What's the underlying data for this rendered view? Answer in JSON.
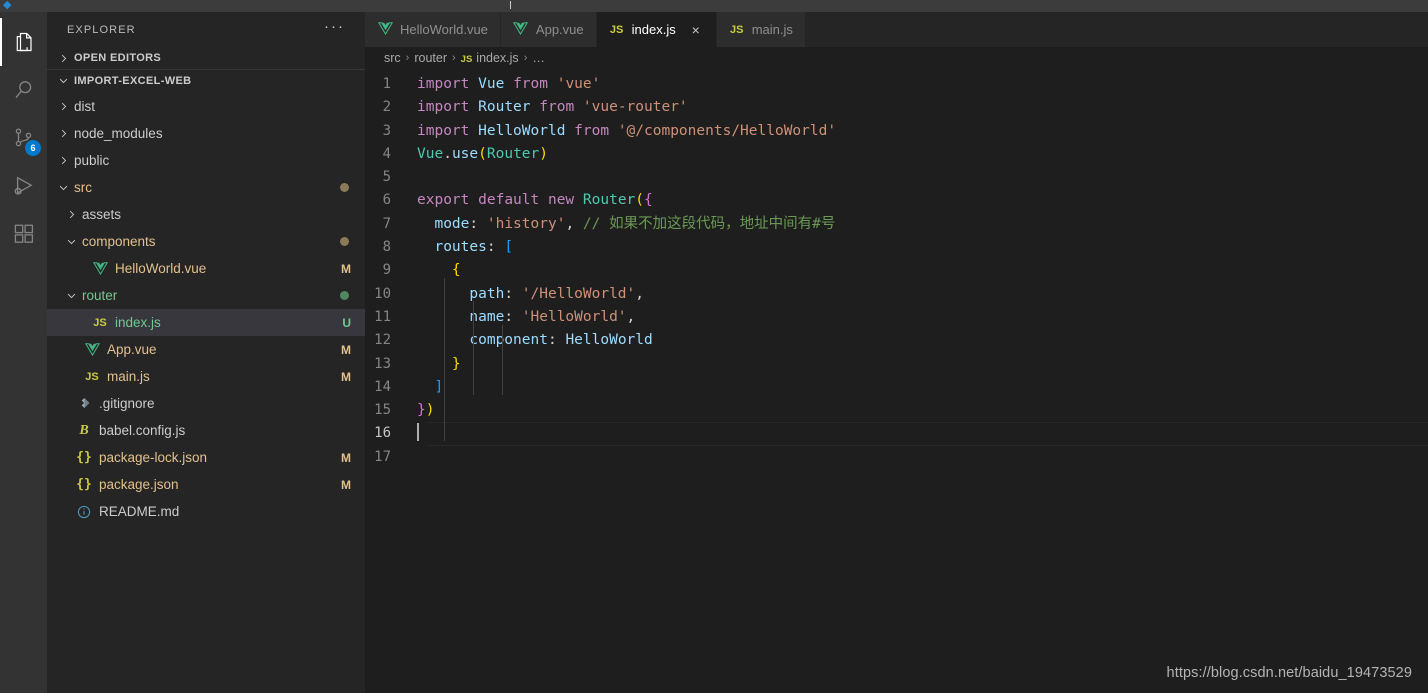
{
  "window": {
    "title_bar_color": "#3c3c3c",
    "background": "#1e1e1e"
  },
  "activity_bar": {
    "items": [
      {
        "name": "explorer",
        "icon": "files-icon",
        "active": true,
        "badge": ""
      },
      {
        "name": "search",
        "icon": "search-icon",
        "active": false,
        "badge": ""
      },
      {
        "name": "source-control",
        "icon": "source-control-icon",
        "active": false,
        "badge": "6"
      },
      {
        "name": "run-and-debug",
        "icon": "run-debug-icon",
        "active": false,
        "badge": ""
      },
      {
        "name": "extensions",
        "icon": "extensions-icon",
        "active": false,
        "badge": ""
      }
    ]
  },
  "sidebar": {
    "title": "EXPLORER",
    "more_actions": "···",
    "sections": [
      {
        "label": "OPEN EDITORS",
        "expanded": false
      },
      {
        "label": "IMPORT-EXCEL-WEB",
        "expanded": true
      }
    ],
    "tree": [
      {
        "label": "dist",
        "type": "folder",
        "depth": 1,
        "expanded": false,
        "icon": "chevron-right-icon",
        "deco": "",
        "dot": "",
        "color": "#cccccc",
        "selected": false
      },
      {
        "label": "node_modules",
        "type": "folder",
        "depth": 1,
        "expanded": false,
        "icon": "chevron-right-icon",
        "deco": "",
        "dot": "",
        "color": "#cccccc",
        "selected": false
      },
      {
        "label": "public",
        "type": "folder",
        "depth": 1,
        "expanded": false,
        "icon": "chevron-right-icon",
        "deco": "",
        "dot": "",
        "color": "#cccccc",
        "selected": false
      },
      {
        "label": "src",
        "type": "folder",
        "depth": 1,
        "expanded": true,
        "icon": "chevron-down-icon",
        "deco": "",
        "dot": "#8c7a56",
        "color": "#e2c08d",
        "selected": false
      },
      {
        "label": "assets",
        "type": "folder",
        "depth": 2,
        "expanded": false,
        "icon": "chevron-right-icon",
        "deco": "",
        "dot": "",
        "color": "#cccccc",
        "selected": false
      },
      {
        "label": "components",
        "type": "folder",
        "depth": 2,
        "expanded": true,
        "icon": "chevron-down-icon",
        "deco": "",
        "dot": "#8c7a56",
        "color": "#e2c08d",
        "selected": false
      },
      {
        "label": "HelloWorld.vue",
        "type": "file",
        "depth": 3,
        "expanded": null,
        "icon": "vue-file-icon",
        "deco": "M",
        "dot": "",
        "color": "#e2c08d",
        "selected": false
      },
      {
        "label": "router",
        "type": "folder",
        "depth": 2,
        "expanded": true,
        "icon": "chevron-down-icon",
        "deco": "",
        "dot": "#4f8a5e",
        "color": "#73c991",
        "selected": false
      },
      {
        "label": "index.js",
        "type": "file",
        "depth": 3,
        "expanded": null,
        "icon": "js-file-icon",
        "deco": "U",
        "dot": "",
        "color": "#73c991",
        "selected": true
      },
      {
        "label": "App.vue",
        "type": "file",
        "depth": 2,
        "expanded": null,
        "icon": "vue-file-icon",
        "deco": "M",
        "dot": "",
        "color": "#e2c08d",
        "selected": false
      },
      {
        "label": "main.js",
        "type": "file",
        "depth": 2,
        "expanded": null,
        "icon": "js-file-icon",
        "deco": "M",
        "dot": "",
        "color": "#e2c08d",
        "selected": false
      },
      {
        "label": ".gitignore",
        "type": "file",
        "depth": 1,
        "expanded": null,
        "icon": "git-file-icon",
        "deco": "",
        "dot": "",
        "color": "#cccccc",
        "selected": false
      },
      {
        "label": "babel.config.js",
        "type": "file",
        "depth": 1,
        "expanded": null,
        "icon": "babel-file-icon",
        "deco": "",
        "dot": "",
        "color": "#cccccc",
        "selected": false
      },
      {
        "label": "package-lock.json",
        "type": "file",
        "depth": 1,
        "expanded": null,
        "icon": "json-file-icon",
        "deco": "M",
        "dot": "",
        "color": "#e2c08d",
        "selected": false
      },
      {
        "label": "package.json",
        "type": "file",
        "depth": 1,
        "expanded": null,
        "icon": "json-file-icon",
        "deco": "M",
        "dot": "",
        "color": "#e2c08d",
        "selected": false
      },
      {
        "label": "README.md",
        "type": "file",
        "depth": 1,
        "expanded": null,
        "icon": "info-file-icon",
        "deco": "",
        "dot": "",
        "color": "#cccccc",
        "selected": false
      }
    ]
  },
  "editor": {
    "tabs": [
      {
        "label": "HelloWorld.vue",
        "icon": "vue-file-icon",
        "active": false,
        "closable": false
      },
      {
        "label": "App.vue",
        "icon": "vue-file-icon",
        "active": false,
        "closable": false
      },
      {
        "label": "index.js",
        "icon": "js-file-icon",
        "active": true,
        "closable": true
      },
      {
        "label": "main.js",
        "icon": "js-file-icon",
        "active": false,
        "closable": false
      }
    ],
    "tab_close_label": "×",
    "breadcrumbs": [
      {
        "label": "src",
        "icon": ""
      },
      {
        "label": "router",
        "icon": ""
      },
      {
        "label": "index.js",
        "icon": "js-file-icon"
      },
      {
        "label": "…",
        "icon": ""
      }
    ],
    "breadcrumb_separator": "›",
    "cursor_line": 16,
    "line_count": 17,
    "lines": [
      {
        "n": "1",
        "tokens": [
          {
            "t": "import",
            "c": "k-kw"
          },
          {
            "t": " ",
            "c": "k-pun"
          },
          {
            "t": "Vue",
            "c": "k-var"
          },
          {
            "t": " ",
            "c": "k-pun"
          },
          {
            "t": "from",
            "c": "k-kw"
          },
          {
            "t": " ",
            "c": "k-pun"
          },
          {
            "t": "'vue'",
            "c": "k-str"
          }
        ]
      },
      {
        "n": "2",
        "tokens": [
          {
            "t": "import",
            "c": "k-kw"
          },
          {
            "t": " ",
            "c": "k-pun"
          },
          {
            "t": "Router",
            "c": "k-var"
          },
          {
            "t": " ",
            "c": "k-pun"
          },
          {
            "t": "from",
            "c": "k-kw"
          },
          {
            "t": " ",
            "c": "k-pun"
          },
          {
            "t": "'vue-router'",
            "c": "k-str"
          }
        ]
      },
      {
        "n": "3",
        "tokens": [
          {
            "t": "import",
            "c": "k-kw"
          },
          {
            "t": " ",
            "c": "k-pun"
          },
          {
            "t": "HelloWorld",
            "c": "k-var"
          },
          {
            "t": " ",
            "c": "k-pun"
          },
          {
            "t": "from",
            "c": "k-kw"
          },
          {
            "t": " ",
            "c": "k-pun"
          },
          {
            "t": "'@/components/HelloWorld'",
            "c": "k-str"
          }
        ]
      },
      {
        "n": "4",
        "tokens": [
          {
            "t": "Vue",
            "c": "k-cls"
          },
          {
            "t": ".",
            "c": "k-pun"
          },
          {
            "t": "use",
            "c": "k-var"
          },
          {
            "t": "(",
            "c": "k-bk1"
          },
          {
            "t": "Router",
            "c": "k-cls"
          },
          {
            "t": ")",
            "c": "k-bk1"
          }
        ]
      },
      {
        "n": "5",
        "tokens": []
      },
      {
        "n": "6",
        "tokens": [
          {
            "t": "export",
            "c": "k-kw"
          },
          {
            "t": " ",
            "c": "k-pun"
          },
          {
            "t": "default",
            "c": "k-kw"
          },
          {
            "t": " ",
            "c": "k-pun"
          },
          {
            "t": "new",
            "c": "k-kw"
          },
          {
            "t": " ",
            "c": "k-pun"
          },
          {
            "t": "Router",
            "c": "k-cls"
          },
          {
            "t": "(",
            "c": "k-bk1"
          },
          {
            "t": "{",
            "c": "k-bk2"
          }
        ]
      },
      {
        "n": "7",
        "tokens": [
          {
            "t": "  ",
            "c": "k-pun"
          },
          {
            "t": "mode",
            "c": "k-var"
          },
          {
            "t": ": ",
            "c": "k-pun"
          },
          {
            "t": "'history'",
            "c": "k-str"
          },
          {
            "t": ", ",
            "c": "k-pun"
          },
          {
            "t": "// 如果不加这段代码，地址中间有#号",
            "c": "k-cmt"
          }
        ]
      },
      {
        "n": "8",
        "tokens": [
          {
            "t": "  ",
            "c": "k-pun"
          },
          {
            "t": "routes",
            "c": "k-var"
          },
          {
            "t": ": ",
            "c": "k-pun"
          },
          {
            "t": "[",
            "c": "k-bk3"
          }
        ]
      },
      {
        "n": "9",
        "tokens": [
          {
            "t": "    ",
            "c": "k-pun"
          },
          {
            "t": "{",
            "c": "k-bk1"
          }
        ]
      },
      {
        "n": "10",
        "tokens": [
          {
            "t": "      ",
            "c": "k-pun"
          },
          {
            "t": "path",
            "c": "k-var"
          },
          {
            "t": ": ",
            "c": "k-pun"
          },
          {
            "t": "'/HelloWorld'",
            "c": "k-str"
          },
          {
            "t": ",",
            "c": "k-pun"
          }
        ]
      },
      {
        "n": "11",
        "tokens": [
          {
            "t": "      ",
            "c": "k-pun"
          },
          {
            "t": "name",
            "c": "k-var"
          },
          {
            "t": ": ",
            "c": "k-pun"
          },
          {
            "t": "'HelloWorld'",
            "c": "k-str"
          },
          {
            "t": ",",
            "c": "k-pun"
          }
        ]
      },
      {
        "n": "12",
        "tokens": [
          {
            "t": "      ",
            "c": "k-pun"
          },
          {
            "t": "component",
            "c": "k-var"
          },
          {
            "t": ": ",
            "c": "k-pun"
          },
          {
            "t": "HelloWorld",
            "c": "k-var"
          }
        ]
      },
      {
        "n": "13",
        "tokens": [
          {
            "t": "    ",
            "c": "k-pun"
          },
          {
            "t": "}",
            "c": "k-bk1"
          }
        ]
      },
      {
        "n": "14",
        "tokens": [
          {
            "t": "  ",
            "c": "k-pun"
          },
          {
            "t": "]",
            "c": "k-bk3"
          }
        ]
      },
      {
        "n": "15",
        "tokens": [
          {
            "t": "}",
            "c": "k-bk2"
          },
          {
            "t": ")",
            "c": "k-bk1"
          }
        ]
      },
      {
        "n": "16",
        "tokens": []
      },
      {
        "n": "17",
        "tokens": []
      }
    ]
  },
  "watermark": "https://blog.csdn.net/baidu_19473529"
}
